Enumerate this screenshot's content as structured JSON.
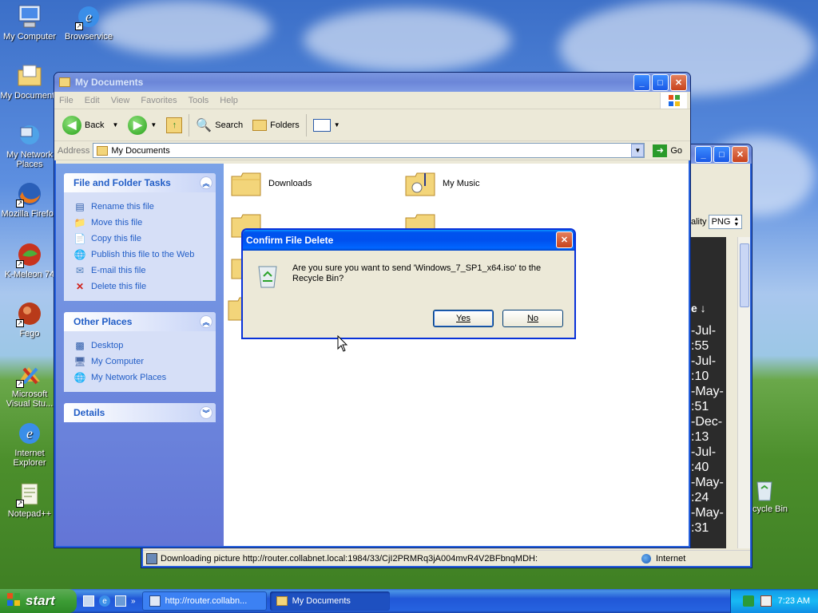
{
  "desktop": {
    "icons": [
      {
        "label": "My Computer"
      },
      {
        "label": "Browservice"
      },
      {
        "label": "My Documents"
      },
      {
        "label": "My Network Places"
      },
      {
        "label": "Mozilla Firefox"
      },
      {
        "label": "K-Meleon 74"
      },
      {
        "label": "Fego"
      },
      {
        "label": "Microsoft Visual Stu..."
      },
      {
        "label": "Internet Explorer"
      },
      {
        "label": "Notepad++"
      },
      {
        "label": "Recycle Bin"
      }
    ]
  },
  "explorer": {
    "title": "My Documents",
    "menu": [
      "File",
      "Edit",
      "View",
      "Favorites",
      "Tools",
      "Help"
    ],
    "toolbar": {
      "back": "Back",
      "search": "Search",
      "folders": "Folders"
    },
    "address_label": "Address",
    "address_value": "My Documents",
    "go_label": "Go",
    "file_tasks": {
      "title": "File and Folder Tasks",
      "items": [
        "Rename this file",
        "Move this file",
        "Copy this file",
        "Publish this file to the Web",
        "E-mail this file",
        "Delete this file"
      ]
    },
    "other_places": {
      "title": "Other Places",
      "items": [
        "Desktop",
        "My Computer",
        "My Network Places"
      ]
    },
    "details": {
      "title": "Details"
    },
    "folders": [
      "Downloads",
      "My Music"
    ]
  },
  "browser_window": {
    "quality_label": "ality",
    "format_value": "PNG",
    "col_header": "e ↓",
    "dates": [
      "-Jul-",
      ":55",
      "-Jul-",
      ":10",
      "-May-",
      ":51",
      "-Dec-",
      ":13",
      "-Jul-",
      ":40",
      "-May-",
      ":24",
      "-May-",
      ":31"
    ],
    "status_text": "Downloading picture http://router.collabnet.local:1984/33/CjI2PRMRq3jA004mvR4V2BFbnqMDH:",
    "zone": "Internet"
  },
  "dialog": {
    "title": "Confirm File Delete",
    "message": "Are you sure you want to send 'Windows_7_SP1_x64.iso' to the Recycle Bin?",
    "yes_label": "Yes",
    "no_label": "No"
  },
  "taskbar": {
    "start_label": "start",
    "tasks": [
      {
        "label": "http://router.collabn..."
      },
      {
        "label": "My Documents"
      }
    ],
    "clock": "7:23 AM"
  },
  "colors": {
    "xp_blue": "#0053ee",
    "link_blue": "#215dc6",
    "start_green": "#3c9c35"
  }
}
